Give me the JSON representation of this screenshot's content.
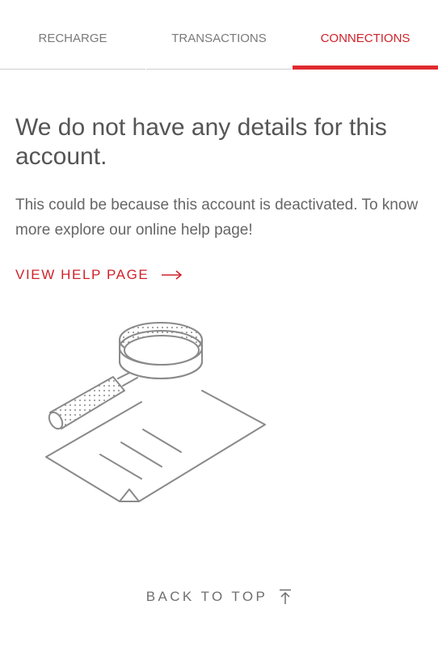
{
  "tabs": [
    {
      "label": "RECHARGE",
      "active": false
    },
    {
      "label": "TRANSACTIONS",
      "active": false
    },
    {
      "label": "CONNECTIONS",
      "active": true
    }
  ],
  "main": {
    "heading": "We do not have any details for this account.",
    "body": "This could be because this account is deactivated. To know more explore our online help page!",
    "help_link_label": "VIEW HELP PAGE",
    "help_link_icon": "arrow-right-icon"
  },
  "illustration": {
    "icon": "magnifier-document-illustration"
  },
  "footer": {
    "back_to_top_label": "BACK TO TOP",
    "back_to_top_icon": "arrow-up-to-top-icon"
  },
  "colors": {
    "accent": "#e02a2f",
    "text": "#555555",
    "muted": "#7a7a7a"
  }
}
